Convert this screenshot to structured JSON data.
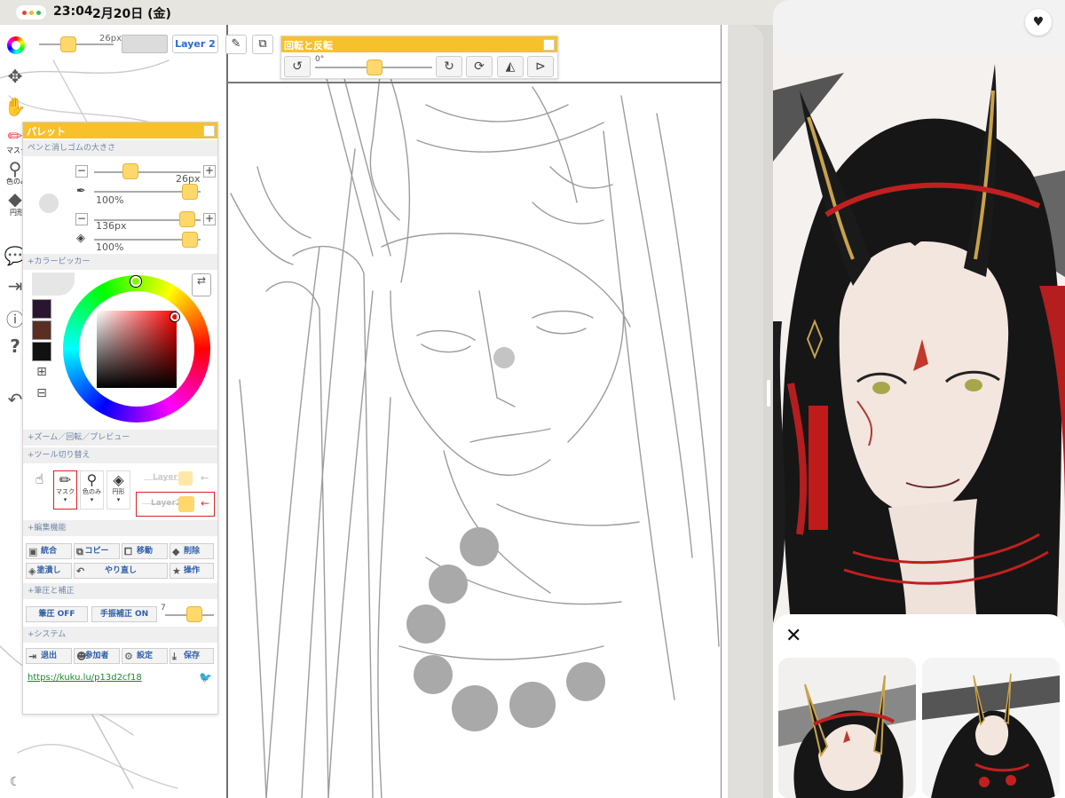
{
  "status_bar": {
    "time": "23:04",
    "date": "2月20日 (金)"
  },
  "toolbar": {
    "brush_size_label": "26px",
    "layer_button": "Layer 2"
  },
  "rotate_panel": {
    "title": "回転と反転",
    "angle": "0°"
  },
  "left_tools": {
    "mask_label": "マスク",
    "eyedropper_label": "色のみ",
    "shape_label": "円形"
  },
  "palette": {
    "title": "パレット",
    "pen_eraser_section": "ペンと消しゴムの大きさ",
    "pen_size": "26px",
    "pen_opacity": "100%",
    "eraser_size": "136px",
    "eraser_opacity": "100%",
    "color_picker_section": "+カラーピッカー",
    "zoom_section": "+ズーム／回転／プレビュー",
    "tool_switch_section": "+ツール切り替え",
    "tool_mask": "マスク",
    "tool_color": "色のみ",
    "tool_shape": "円形",
    "layer1": "Layer1",
    "layer2": "Layer2",
    "edit_section": "+編集機能",
    "edit_buttons": {
      "merge": "統合",
      "copy": "コピー",
      "move": "移動",
      "delete": "削除",
      "fill": "塗潰し",
      "redo": "やり直し",
      "operate": "操作"
    },
    "pressure_section": "+筆圧と補正",
    "pressure_off": "筆圧 OFF",
    "stabilizer_on": "手振補正 ON",
    "stabilizer_value": "7",
    "system_section": "+システム",
    "system_buttons": {
      "exit": "退出",
      "participants": "参加者",
      "settings": "設定",
      "save": "保存"
    },
    "link": "https://kuku.lu/p13d2cf18"
  },
  "colors": {
    "accent": "#f7c12b",
    "knob": "#ffd86b",
    "link": "#1a8a2a",
    "swatch1": "#2a1530",
    "swatch2": "#5a2e22",
    "swatch3": "#111111"
  }
}
